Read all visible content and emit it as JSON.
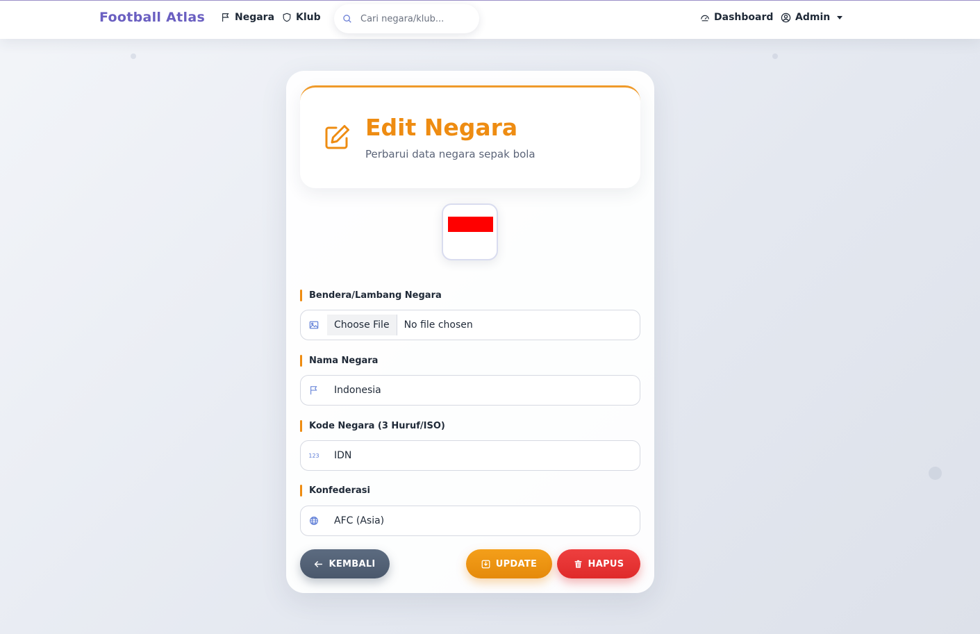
{
  "navbar": {
    "brand": "Football Atlas",
    "links": [
      {
        "label": "Negara",
        "icon": "flag-icon"
      },
      {
        "label": "Klub",
        "icon": "shield-icon"
      }
    ],
    "search_placeholder": "Cari negara/klub...",
    "dashboard_label": "Dashboard",
    "admin_label": "Admin"
  },
  "header": {
    "title": "Edit Negara",
    "subtitle": "Perbarui data negara sepak bola"
  },
  "flag_preview": {
    "top_color": "#ff0000",
    "bottom_color": "#ffffff"
  },
  "form": {
    "flag_label": "Bendera/Lambang Negara",
    "file_button": "Choose File",
    "file_status": "No file chosen",
    "name_label": "Nama Negara",
    "name_value": "Indonesia",
    "code_label": "Kode Negara (3 Huruf/ISO)",
    "code_icon_text": "123",
    "code_value": "IDN",
    "confed_label": "Konfederasi",
    "confed_value": "AFC (Asia)"
  },
  "buttons": {
    "back": "KEMBALI",
    "update": "UPDATE",
    "delete": "HAPUS"
  },
  "colors": {
    "brand": "#6a5fc1",
    "accent": "#ee8c12",
    "danger": "#df2a2a",
    "secondary": "#4a586c"
  }
}
